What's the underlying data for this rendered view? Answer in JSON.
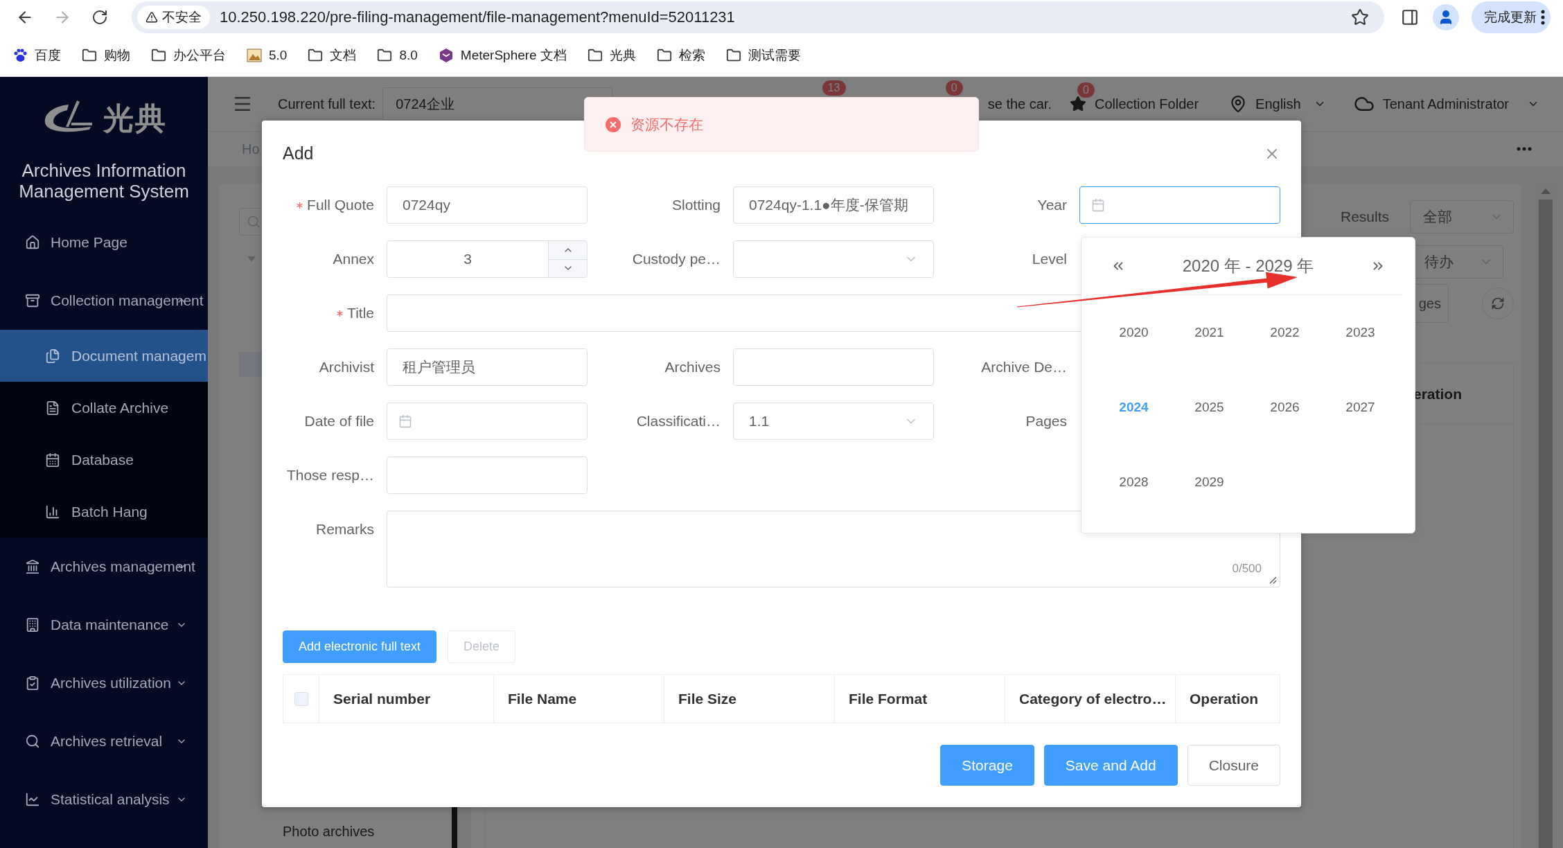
{
  "browser": {
    "security": "不安全",
    "url": "10.250.198.220/pre-filing-management/file-management?menuId=52011231",
    "update_button": "完成更新",
    "bookmarks": [
      {
        "label": "百度",
        "kind": "baidu"
      },
      {
        "label": "购物",
        "kind": "folder"
      },
      {
        "label": "办公平台",
        "kind": "folder"
      },
      {
        "label": "5.0",
        "kind": "image"
      },
      {
        "label": "文档",
        "kind": "folder"
      },
      {
        "label": "8.0",
        "kind": "folder"
      },
      {
        "label": "MeterSphere 文档",
        "kind": "app"
      },
      {
        "label": "光典",
        "kind": "folder"
      },
      {
        "label": "检索",
        "kind": "folder"
      },
      {
        "label": "测试需要",
        "kind": "folder"
      }
    ]
  },
  "sidebar": {
    "logo_text": "光典",
    "title": "Archives Information Management System",
    "items": [
      {
        "label": "Home Page",
        "kind": "link"
      },
      {
        "label": "Collection management",
        "kind": "group",
        "expanded": true,
        "children": [
          {
            "label": "Document managem",
            "selected": true
          },
          {
            "label": "Collate Archive",
            "selected": false
          },
          {
            "label": "Database",
            "selected": false
          },
          {
            "label": "Batch Hang",
            "selected": false
          }
        ]
      },
      {
        "label": "Archives management",
        "kind": "group",
        "expanded": false
      },
      {
        "label": "Data maintenance",
        "kind": "group",
        "expanded": false
      },
      {
        "label": "Archives utilization",
        "kind": "group",
        "expanded": false
      },
      {
        "label": "Archives retrieval",
        "kind": "group",
        "expanded": false
      },
      {
        "label": "Statistical analysis",
        "kind": "group",
        "expanded": false
      }
    ]
  },
  "header": {
    "search_label": "Current full text:",
    "search_value": "0724企业",
    "badges": [
      "13",
      "0"
    ],
    "partial_text": "se the car.",
    "favorites": {
      "label": "Collection Folder",
      "badge": "0"
    },
    "language": "English",
    "user": "Tenant Administrator"
  },
  "tabs": [
    {
      "label": "Ho"
    }
  ],
  "background": {
    "results_label": "Results",
    "results_value": "全部",
    "status_value": "待办",
    "button_fragment": "ges",
    "column_fragment": "eration",
    "tree_item": "Photo archives"
  },
  "toast": {
    "kind": "error",
    "message": "资源不存在"
  },
  "modal": {
    "title": "Add",
    "rows": [
      [
        {
          "label": "Full Quote",
          "required": true,
          "kind": "text",
          "value": "0724qy",
          "focused": false
        },
        {
          "label": "Slotting",
          "required": false,
          "kind": "text",
          "value": "0724qy-1.1●年度-保管期",
          "focused": false
        },
        {
          "label": "Year",
          "required": false,
          "kind": "date",
          "focused": true
        }
      ],
      [
        {
          "label": "Annex",
          "required": false,
          "kind": "number",
          "value": "3",
          "focused": false
        },
        {
          "label": "Custody pe…",
          "required": false,
          "kind": "select",
          "focused": false
        },
        {
          "label": "Level",
          "required": false,
          "kind": "covered"
        }
      ],
      [
        {
          "label": "Title",
          "required": true,
          "kind": "longtext",
          "focused": false
        }
      ],
      [
        {
          "label": "Archivist",
          "required": false,
          "kind": "text",
          "value": "租户管理员",
          "focused": false
        },
        {
          "label": "Archives",
          "required": false,
          "kind": "text",
          "focused": false
        },
        {
          "label": "Archive De…",
          "required": false,
          "kind": "covered"
        }
      ],
      [
        {
          "label": "Date of file",
          "required": false,
          "kind": "date",
          "focused": false
        },
        {
          "label": "Classificati…",
          "required": false,
          "kind": "select",
          "value": "1.1",
          "focused": false
        },
        {
          "label": "Pages",
          "required": false,
          "kind": "covered"
        }
      ],
      [
        {
          "label": "Those resp…",
          "required": false,
          "kind": "text",
          "focused": false
        }
      ],
      [
        {
          "label": "Remarks",
          "required": false,
          "kind": "textarea",
          "counter": "0/500",
          "focused": false
        }
      ]
    ],
    "add_button": "Add electronic full text",
    "delete_button": {
      "label": "Delete",
      "disabled": true
    },
    "table": {
      "select_all_checked": false,
      "columns": [
        "Serial number",
        "File Name",
        "File Size",
        "File Format",
        "Category of electro…",
        "Operation"
      ]
    },
    "footer_buttons": [
      {
        "label": "Storage",
        "kind": "primary"
      },
      {
        "label": "Save and Add",
        "kind": "primary"
      },
      {
        "label": "Closure",
        "kind": "default"
      }
    ]
  },
  "year_picker": {
    "title": "2020 年 - 2029 年",
    "years": [
      {
        "label": "2020",
        "current": false
      },
      {
        "label": "2021",
        "current": false
      },
      {
        "label": "2022",
        "current": false
      },
      {
        "label": "2023",
        "current": false
      },
      {
        "label": "2024",
        "current": true
      },
      {
        "label": "2025",
        "current": false
      },
      {
        "label": "2026",
        "current": false
      },
      {
        "label": "2027",
        "current": false
      },
      {
        "label": "2028",
        "current": false
      },
      {
        "label": "2029",
        "current": false
      }
    ]
  }
}
